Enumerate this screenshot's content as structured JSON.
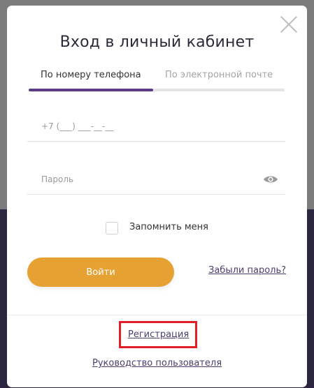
{
  "modal": {
    "title": "Вход в личный кабинет",
    "tabs": [
      {
        "label": "По номеру телефона",
        "active": true
      },
      {
        "label": "По электронной почте",
        "active": false
      }
    ],
    "phone_field": {
      "placeholder": "+7 (___) ___-__-__",
      "value": ""
    },
    "password_field": {
      "placeholder": "Пароль",
      "value": ""
    },
    "remember_label": "Запомнить меня",
    "login_button": "Войти",
    "forgot_link": "Забыли пароль?",
    "register_link": "Регистрация",
    "guide_link": "Руководство пользователя"
  },
  "colors": {
    "accent_button": "#e5a233",
    "tab_active": "#5b3a87",
    "link": "#4b3d6e",
    "highlight_box": "#e01f26",
    "overlay_bottom": "#2c2541"
  },
  "icons": {
    "close": "close-icon",
    "password_toggle": "eye-icon"
  }
}
